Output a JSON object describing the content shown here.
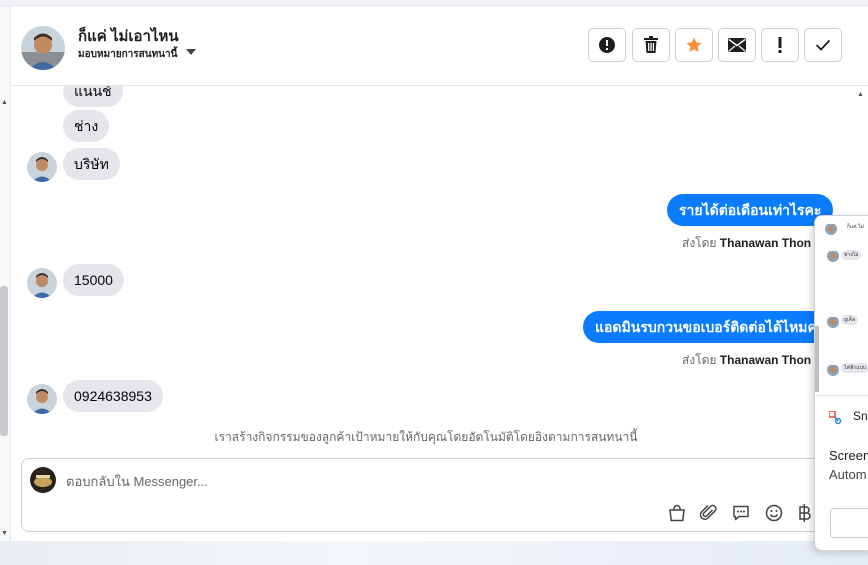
{
  "conversation": {
    "contact_name": "ก็แค่ ไม่เอาไหน",
    "assign_label": "มอบหมายการสนทนานี้"
  },
  "toolbar": [
    {
      "name": "spam-button",
      "icon": "exclamation-circle-icon"
    },
    {
      "name": "delete-button",
      "icon": "trash-icon"
    },
    {
      "name": "star-button",
      "icon": "star-icon"
    },
    {
      "name": "mark-unread-button",
      "icon": "envelope-icon"
    },
    {
      "name": "follow-up-button",
      "icon": "exclamation-icon"
    },
    {
      "name": "mark-done-button",
      "icon": "check-icon"
    }
  ],
  "messages": [
    {
      "type": "in",
      "text": "แนนช์"
    },
    {
      "type": "in",
      "text": "ช่าง"
    },
    {
      "type": "in",
      "text": "บริษัท"
    },
    {
      "type": "out",
      "text": "รายได้ต่อเดือนเท่าไรคะ"
    },
    {
      "type": "in",
      "text": "15000"
    },
    {
      "type": "out",
      "text": "แอดมินรบกวนขอเบอร์ติดต่อได้ไหมคะ"
    },
    {
      "type": "in",
      "text": "0924638953"
    }
  ],
  "sent_by": {
    "prefix": "ส่งโดย",
    "agent": "Thanawan Thon"
  },
  "system_note": "เราสร้างกิจกรรมของลูกค้าเป้าหมายให้กับคุณโดยอัตโนมัติโดยอิงตามการสนทนานี้",
  "composer": {
    "placeholder": "ตอบกลับใน Messenger...",
    "icons": [
      "shopping-bag-icon",
      "paperclip-icon",
      "saved-reply-icon",
      "emoji-icon",
      "baht-icon"
    ]
  },
  "popup": {
    "mini_name": "ก็แค่ ไม่",
    "mini_messages": [
      "ช่างไม่",
      "ยูเค็ล",
      "ไฟฟ้าแบบ"
    ],
    "app_label": "Sni",
    "line1": "Screen",
    "line2": "Autom"
  },
  "colors": {
    "outgoing_bubble": "#0a7cff",
    "incoming_bubble": "#e4e6eb",
    "star": "#f7923b"
  }
}
